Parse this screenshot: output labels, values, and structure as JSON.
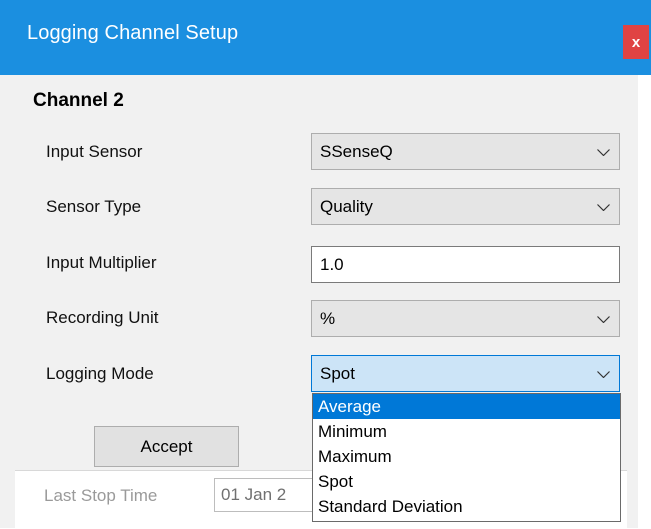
{
  "window": {
    "title": "Logging Channel Setup",
    "close_label": "x"
  },
  "channel": {
    "title": "Channel 2"
  },
  "fields": {
    "input_sensor": {
      "label": "Input Sensor",
      "value": "SSenseQ"
    },
    "sensor_type": {
      "label": "Sensor Type",
      "value": "Quality"
    },
    "input_multiplier": {
      "label": "Input Multiplier",
      "value": "1.0"
    },
    "recording_unit": {
      "label": "Recording Unit",
      "value": "%"
    },
    "logging_mode": {
      "label": "Logging Mode",
      "value": "Spot",
      "options": [
        "Average",
        "Minimum",
        "Maximum",
        "Spot",
        "Standard Deviation"
      ],
      "highlighted": "Average"
    }
  },
  "buttons": {
    "accept": "Accept"
  },
  "background_form": {
    "last_stop_label": "Last Stop Time",
    "last_stop_value": "01 Jan 2"
  },
  "colors": {
    "title_bar": "#1b8fe0",
    "close_button": "#e04343",
    "selection": "#0078d7"
  }
}
